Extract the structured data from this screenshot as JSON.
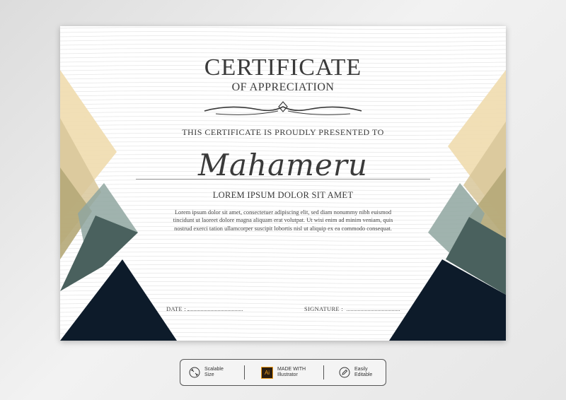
{
  "certificate": {
    "title": "CERTIFICATE",
    "subtitle": "OF APPRECIATION",
    "presented_to": "THIS CERTIFICATE IS PROUDLY PRESENTED TO",
    "recipient_name": "Mahameru",
    "heading": "LOREM IPSUM DOLOR SIT AMET",
    "body_lines": [
      "Lorem ipsum dolor sit amet, consectetuer adipiscing elit, sed diam nonummy nibh euismod",
      "tincidunt ut laoreet dolore magna aliquam erat volutpat. Ut wisi enim ad minim veniam, quis",
      "nostrud exerci tation ullamcorper suscipit lobortis nisl ut aliquip ex ea commodo consequat."
    ],
    "date_label": "DATE :",
    "signature_label": "SIGNATURE :"
  },
  "footer": {
    "scalable_line1": "Scalable",
    "scalable_line2": "Size",
    "ai_badge": "Ai",
    "made_with_line1": "MADE WITH",
    "made_with_line2": "Illustrator",
    "editable_line1": "Easily",
    "editable_line2": "Editable"
  },
  "colors": {
    "gold_light": "#f0dcae",
    "gold_mid": "#d8c79a",
    "olive": "#b5a878",
    "sage": "#8fa6a0",
    "teal_dark": "#4a615e",
    "navy": "#0d1b2a",
    "text": "#3a3a3a",
    "ai_orange": "#f29f1b",
    "ai_bg": "#2b1d0e"
  }
}
